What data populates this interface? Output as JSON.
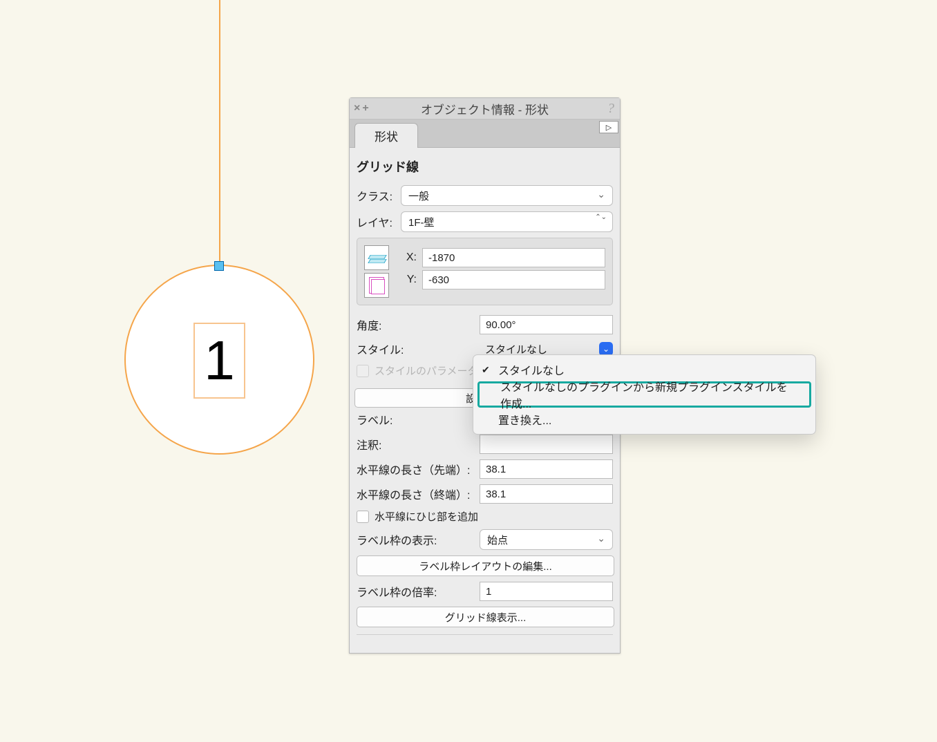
{
  "canvas": {
    "grid_label": "1"
  },
  "palette": {
    "title": "オブジェクト情報 - 形状",
    "tab": "形状",
    "section": "グリッド線",
    "class_label": "クラス:",
    "class_value": "一般",
    "layer_label": "レイヤ:",
    "layer_value": "1F-壁",
    "x_label": "X:",
    "x_value": "-1870",
    "y_label": "Y:",
    "y_value": "-630",
    "angle_label": "角度:",
    "angle_value": "90.00°",
    "style_label": "スタイル:",
    "style_value": "スタイルなし",
    "style_params_label": "スタイルのパラメータ",
    "settings_btn_fragment": "設",
    "label_label": "ラベル:",
    "label_value": "",
    "note_label": "注釈:",
    "note_value": "",
    "hlen_start_label": "水平線の長さ（先端）:",
    "hlen_start_value": "38.1",
    "hlen_end_label": "水平線の長さ（終端）:",
    "hlen_end_value": "38.1",
    "elbow_label": "水平線にひじ部を追加",
    "labelframe_show_label": "ラベル枠の表示:",
    "labelframe_show_value": "始点",
    "labelframe_edit_btn": "ラベル枠レイアウトの編集...",
    "labelframe_scale_label": "ラベル枠の倍率:",
    "labelframe_scale_value": "1",
    "gridline_show_btn": "グリッド線表示..."
  },
  "menu": {
    "item_none": "スタイルなし",
    "item_create": "スタイルなしのプラグインから新規プラグインスタイルを作成...",
    "item_replace": "置き換え..."
  }
}
